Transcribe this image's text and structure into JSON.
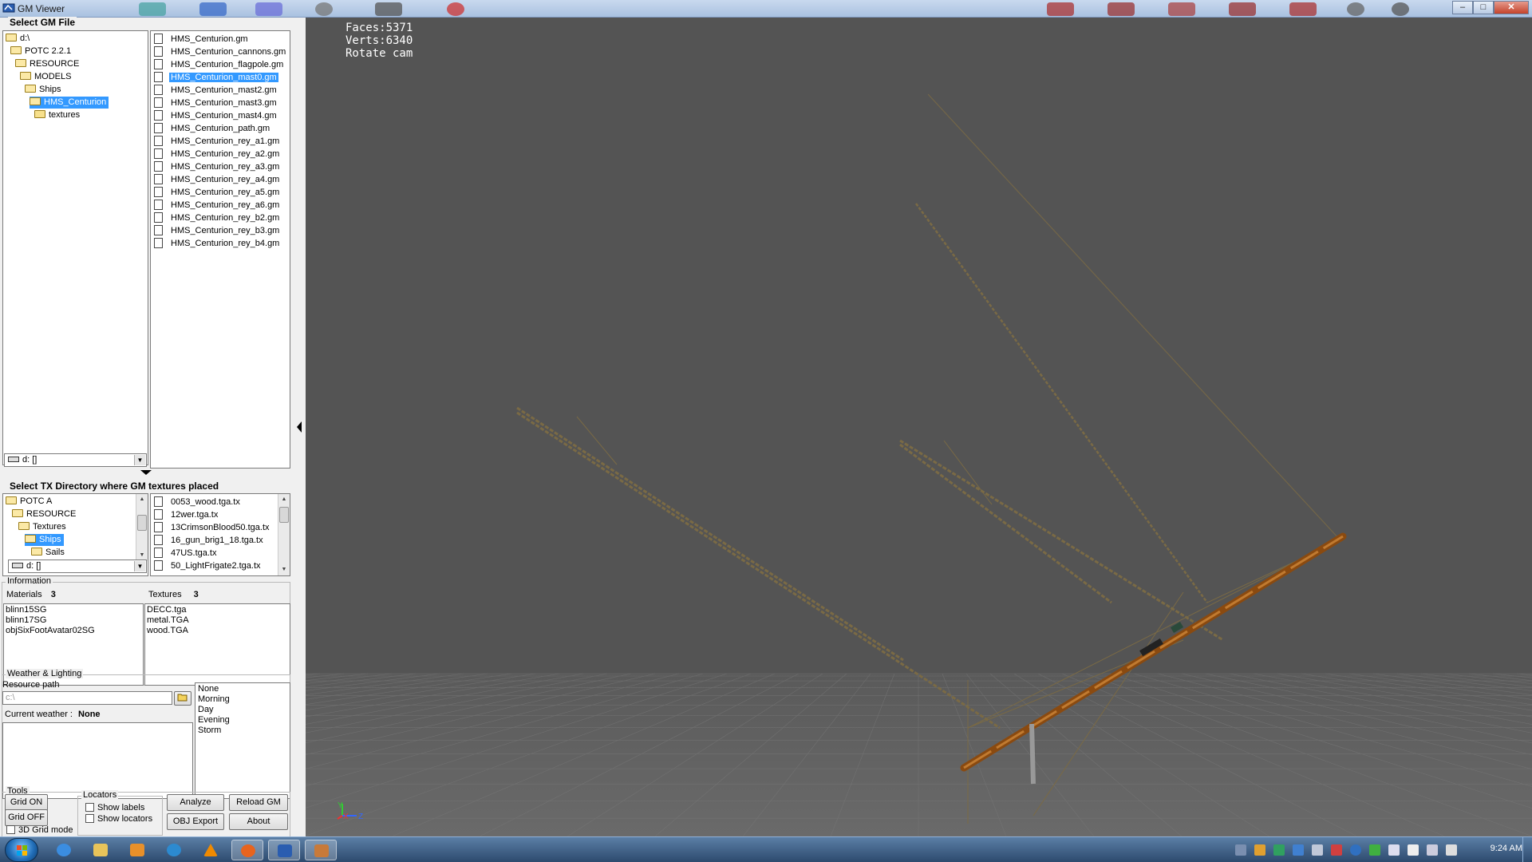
{
  "window": {
    "title": "GM Viewer",
    "buttons": [
      "–",
      "□",
      "✕"
    ]
  },
  "gm_file": {
    "section_title": "Select GM File",
    "tree": [
      {
        "label": "d:\\",
        "indent": 0,
        "open": true
      },
      {
        "label": "POTC 2.2.1",
        "indent": 1,
        "open": true
      },
      {
        "label": "RESOURCE",
        "indent": 2,
        "open": true
      },
      {
        "label": "MODELS",
        "indent": 3,
        "open": true
      },
      {
        "label": "Ships",
        "indent": 4,
        "open": true
      },
      {
        "label": "HMS_Centurion",
        "indent": 5,
        "open": true,
        "selected": true
      },
      {
        "label": "textures",
        "indent": 6,
        "open": false
      }
    ],
    "drive": "d: []",
    "files": [
      "HMS_Centurion.gm",
      "HMS_Centurion_cannons.gm",
      "HMS_Centurion_flagpole.gm",
      "HMS_Centurion_mast0.gm",
      "HMS_Centurion_mast2.gm",
      "HMS_Centurion_mast3.gm",
      "HMS_Centurion_mast4.gm",
      "HMS_Centurion_path.gm",
      "HMS_Centurion_rey_a1.gm",
      "HMS_Centurion_rey_a2.gm",
      "HMS_Centurion_rey_a3.gm",
      "HMS_Centurion_rey_a4.gm",
      "HMS_Centurion_rey_a5.gm",
      "HMS_Centurion_rey_a6.gm",
      "HMS_Centurion_rey_b2.gm",
      "HMS_Centurion_rey_b3.gm",
      "HMS_Centurion_rey_b4.gm"
    ],
    "selected_file": "HMS_Centurion_mast0.gm"
  },
  "tx_dir": {
    "section_title": "Select TX Directory where GM textures placed",
    "tree": [
      {
        "label": "POTC A",
        "indent": 0
      },
      {
        "label": "RESOURCE",
        "indent": 1
      },
      {
        "label": "Textures",
        "indent": 2
      },
      {
        "label": "Ships",
        "indent": 3,
        "selected": true
      },
      {
        "label": "Sails",
        "indent": 4
      }
    ],
    "drive": "d: []",
    "files": [
      "0053_wood.tga.tx",
      "12wer.tga.tx",
      "13CrimsonBlood50.tga.tx",
      "16_gun_brig1_18.tga.tx",
      "47US.tga.tx",
      "50_LightFrigate2.tga.tx"
    ]
  },
  "information": {
    "label": "Information",
    "materials_label": "Materials",
    "materials_count": "3",
    "textures_label": "Textures",
    "textures_count": "3",
    "materials": [
      "blinn15SG",
      "blinn17SG",
      "objSixFootAvatar02SG"
    ],
    "textures": [
      "DECC.tga",
      "metal.TGA",
      "wood.TGA"
    ]
  },
  "weather": {
    "label": "Weather & Lighting",
    "resource_path_label": "Resource path",
    "resource_path_value": "c:\\",
    "current_weather_label": "Current weather :",
    "current_weather_value": "None",
    "options": [
      "None",
      "Morning",
      "Day",
      "Evening",
      "Storm"
    ]
  },
  "tools": {
    "label": "Tools",
    "grid_on": "Grid ON",
    "grid_off": "Grid OFF",
    "grid_3d": "3D Grid mode",
    "locators_label": "Locators",
    "show_labels": "Show labels",
    "show_locators": "Show locators",
    "analyze": "Analyze",
    "reload": "Reload GM",
    "obj_export": "OBJ Export",
    "about": "About"
  },
  "viewport": {
    "faces": "Faces:5371",
    "verts": "Verts:6340",
    "mode": "Rotate cam",
    "background": "#545454",
    "axes": {
      "y": "Y",
      "x": "X",
      "z": "Z"
    }
  },
  "taskbar": {
    "clock": "9:24 AM",
    "apps": [
      "internet-explorer",
      "file-explorer",
      "media-player",
      "search",
      "vlc",
      "firefox",
      "gm-viewer",
      "tool-app"
    ]
  }
}
